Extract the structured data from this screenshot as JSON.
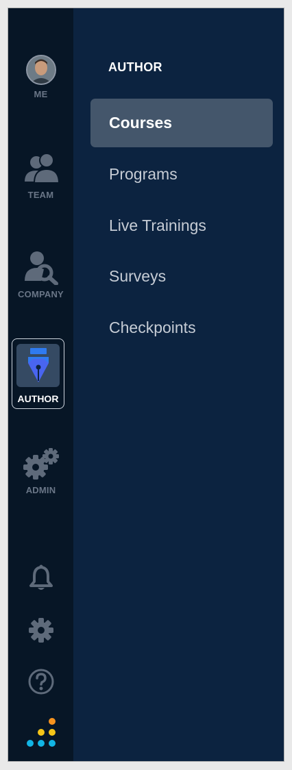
{
  "rail": {
    "me_label": "ME",
    "team_label": "TEAM",
    "company_label": "COMPANY",
    "author_label": "AUTHOR",
    "admin_label": "ADMIN",
    "icons": {
      "me": "avatar",
      "team": "team-icon",
      "company": "company-search-icon",
      "author": "pen-nib-icon",
      "admin": "gears-icon",
      "notifications": "bell-icon",
      "settings": "gear-icon",
      "help": "question-circle-icon",
      "logo": "dots-logo-icon"
    }
  },
  "panel": {
    "title": "AUTHOR",
    "items": [
      {
        "label": "Courses",
        "active": true
      },
      {
        "label": "Programs",
        "active": false
      },
      {
        "label": "Live Trainings",
        "active": false
      },
      {
        "label": "Surveys",
        "active": false
      },
      {
        "label": "Checkpoints",
        "active": false
      }
    ]
  },
  "colors": {
    "rail_bg": "#071626",
    "panel_bg": "#0c2340",
    "active_item_bg": "#44566b",
    "icon_muted": "#5e6a7a",
    "author_blue": "#2f7bf0",
    "logo_orange": "#f7931e",
    "logo_yellow": "#f5c518",
    "logo_cyan": "#12b5e5"
  }
}
